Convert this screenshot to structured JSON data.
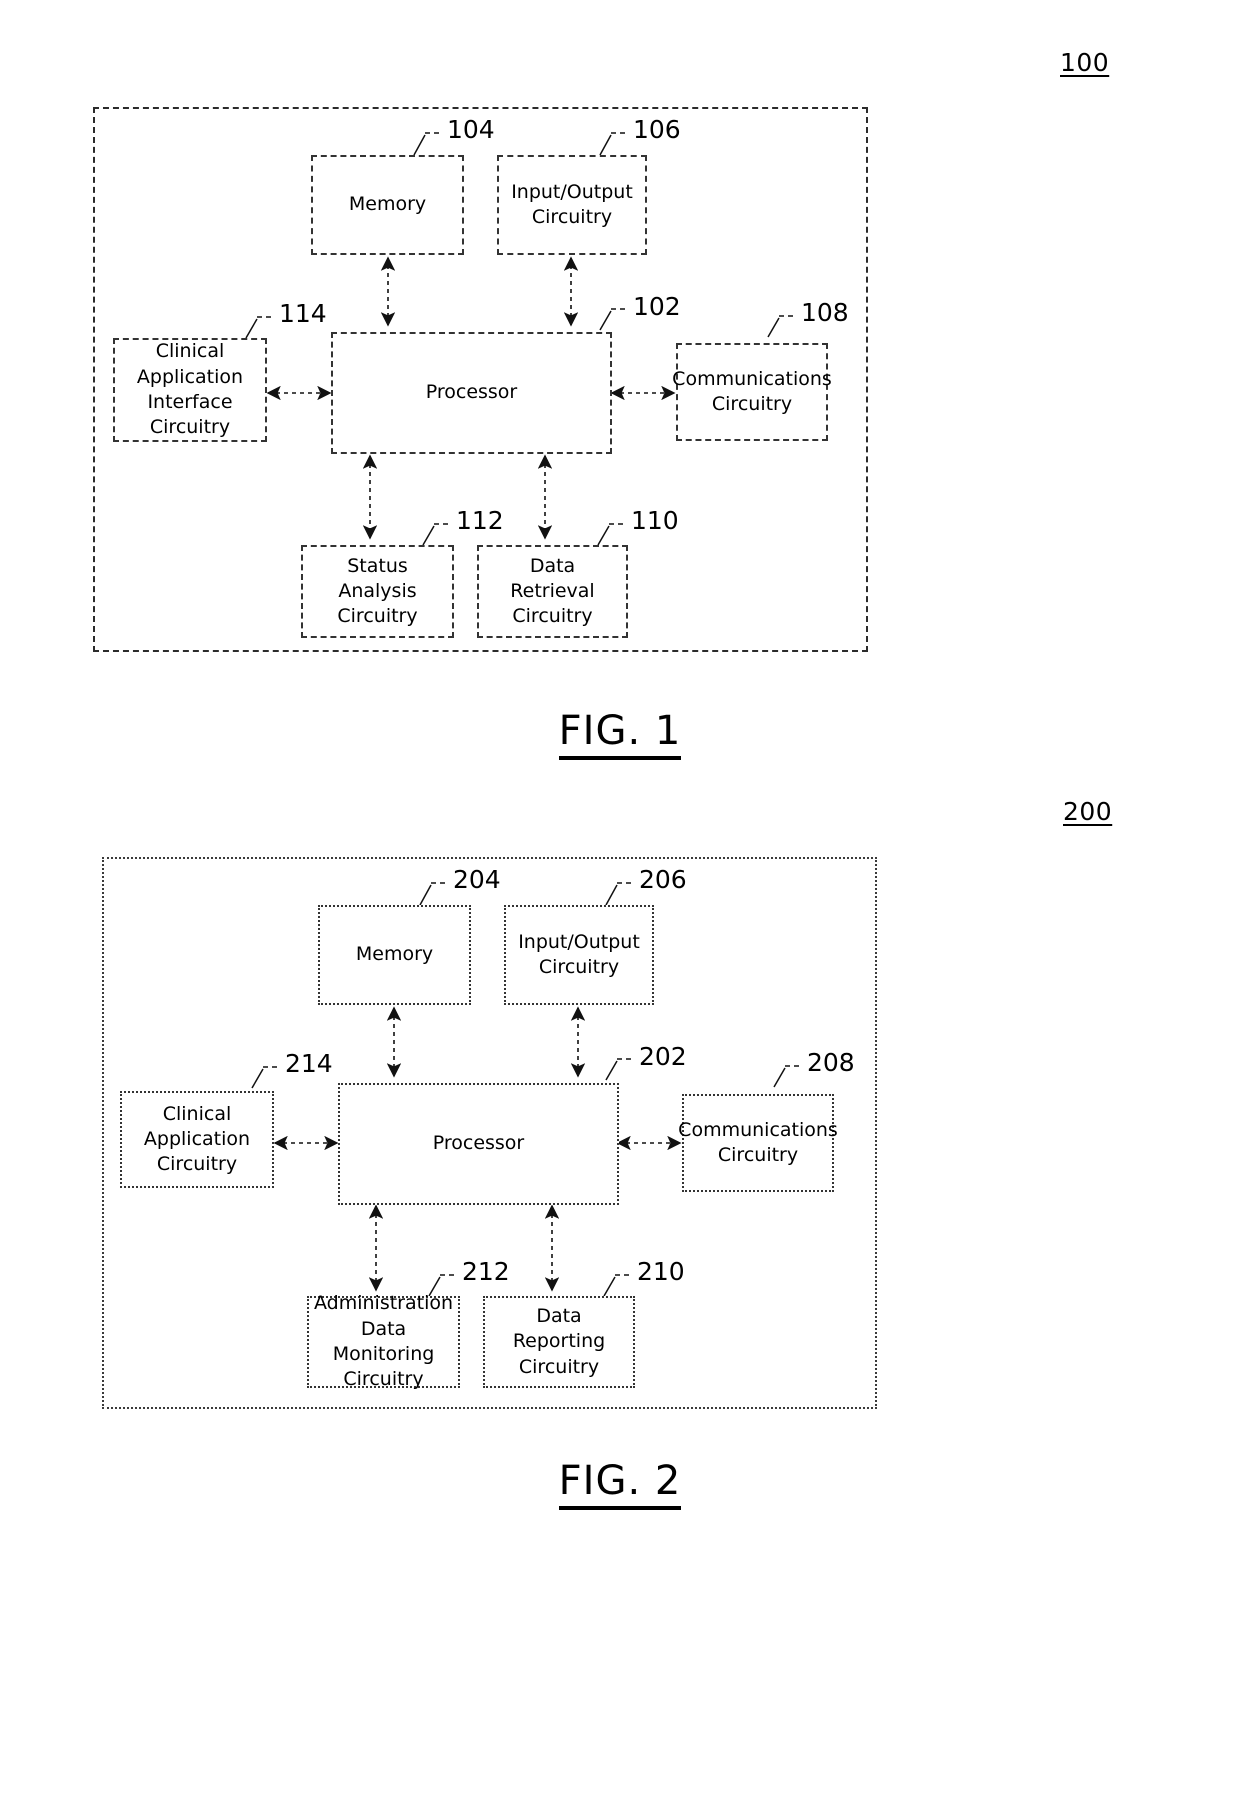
{
  "page": {
    "background": "#ffffff",
    "ink": "#000000"
  },
  "figures": [
    {
      "id": "figure-1",
      "ref_label": "100",
      "caption": "FIG. 1",
      "container_border": "dashed",
      "nodes": [
        {
          "key": "memory",
          "label": "Memory",
          "numeral": "104"
        },
        {
          "key": "io",
          "label": "Input/Output\nCircuitry",
          "numeral": "106"
        },
        {
          "key": "processor",
          "label": "Processor",
          "numeral": "102"
        },
        {
          "key": "clinical",
          "label": "Clinical\nApplication\nInterface\nCircuitry",
          "numeral": "114"
        },
        {
          "key": "comms",
          "label": "Communications\nCircuitry",
          "numeral": "108"
        },
        {
          "key": "status",
          "label": "Status Analysis\nCircuitry",
          "numeral": "112"
        },
        {
          "key": "retrieval",
          "label": "Data Retrieval\nCircuitry",
          "numeral": "110"
        }
      ]
    },
    {
      "id": "figure-2",
      "ref_label": "200",
      "caption": "FIG. 2",
      "container_border": "dotted",
      "nodes": [
        {
          "key": "memory",
          "label": "Memory",
          "numeral": "204"
        },
        {
          "key": "io",
          "label": "Input/Output\nCircuitry",
          "numeral": "206"
        },
        {
          "key": "processor",
          "label": "Processor",
          "numeral": "202"
        },
        {
          "key": "clinical",
          "label": "Clinical\nApplication\nCircuitry",
          "numeral": "214"
        },
        {
          "key": "comms",
          "label": "Communications\nCircuitry",
          "numeral": "208"
        },
        {
          "key": "admin",
          "label": "Administration\nData Monitoring\nCircuitry",
          "numeral": "212"
        },
        {
          "key": "reporting",
          "label": "Data Reporting\nCircuitry",
          "numeral": "210"
        }
      ]
    }
  ]
}
